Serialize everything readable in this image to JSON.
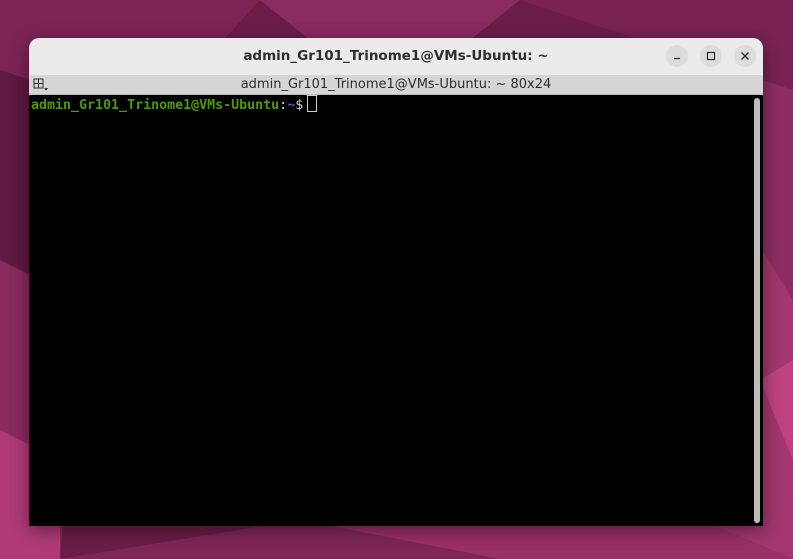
{
  "window": {
    "title": "admin_Gr101_Trinome1@VMs-Ubuntu: ~",
    "buttons": {
      "minimize": "minimize-icon",
      "maximize": "maximize-icon",
      "close": "close-icon"
    }
  },
  "tab": {
    "title": "admin_Gr101_Trinome1@VMs-Ubuntu: ~ 80x24",
    "menu_icon": "terminal-menu-icon"
  },
  "terminal": {
    "prompt_user_host": "admin_Gr101_Trinome1@VMs-Ubuntu",
    "prompt_separator": ":",
    "prompt_path": "~",
    "prompt_symbol": "$"
  },
  "colors": {
    "prompt_user": "#4e9a06",
    "prompt_path": "#3465a4",
    "terminal_bg": "#000000",
    "headerbar_bg": "#ebebeb"
  }
}
